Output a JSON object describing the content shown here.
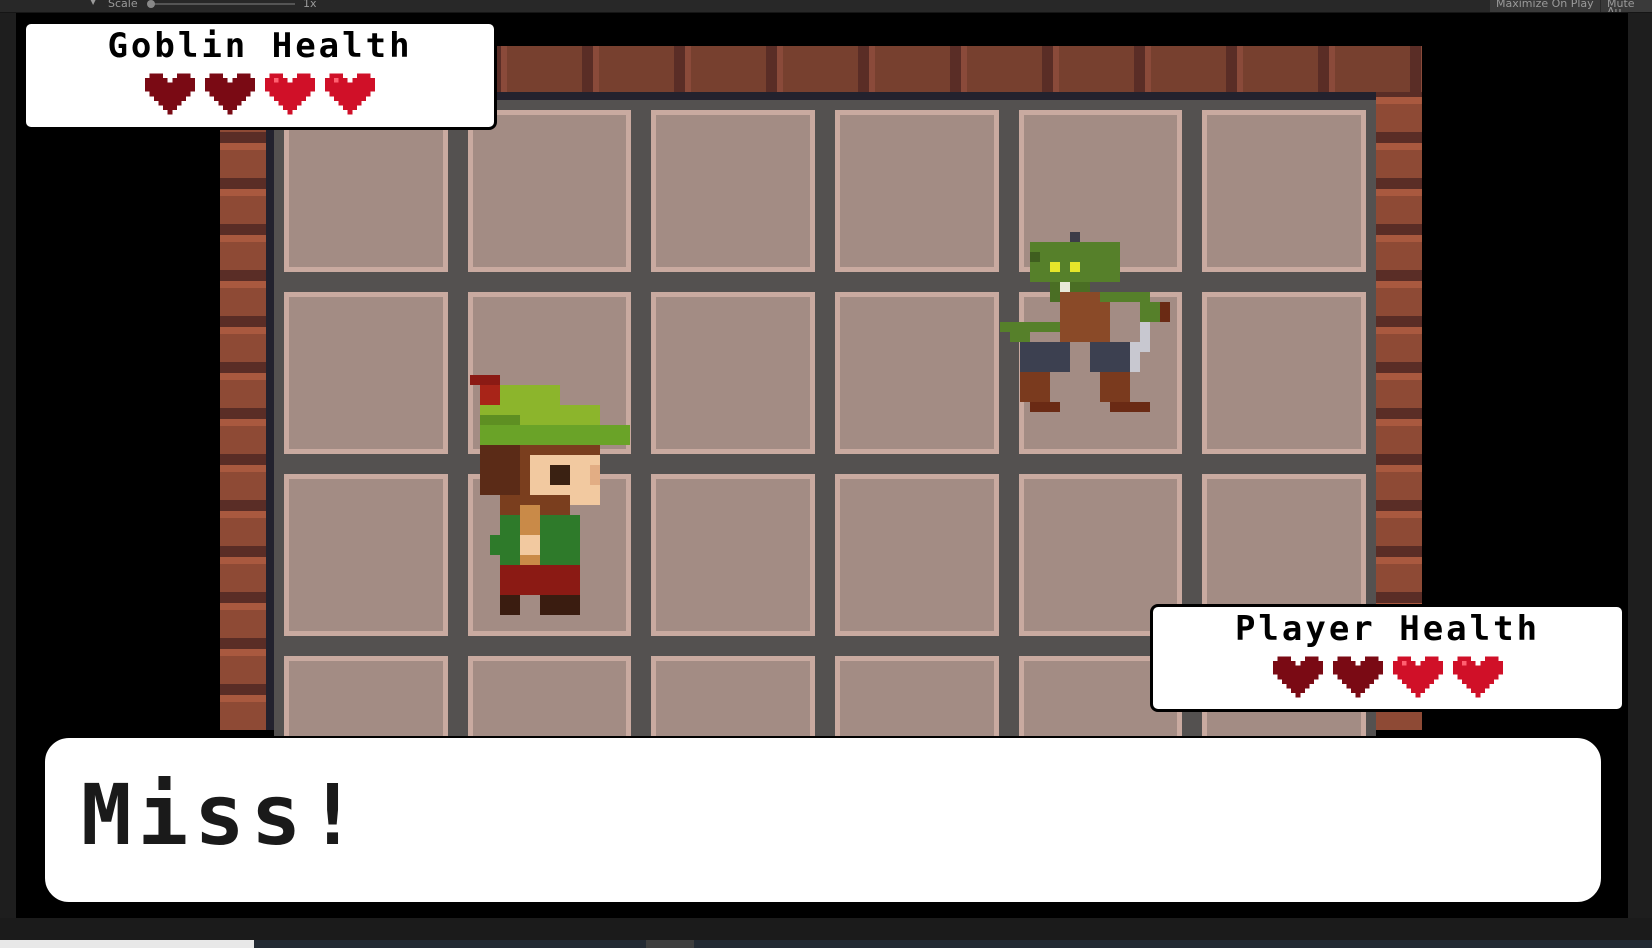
{
  "editor": {
    "scale_label": "Scale",
    "scale_value": "1x",
    "maximize_on_play": "Maximize On Play",
    "mute_audio": "Mute Au"
  },
  "goblin_panel": {
    "title": "Goblin Health",
    "hearts": 4
  },
  "player_panel": {
    "title": "Player Health",
    "hearts": 4
  },
  "message": "Miss!"
}
